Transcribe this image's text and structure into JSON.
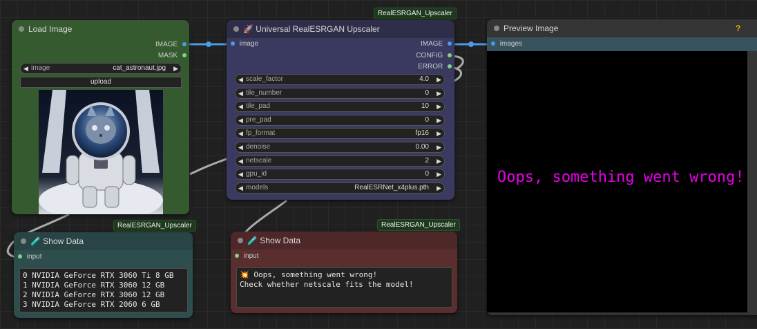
{
  "load_image": {
    "title": "Load Image",
    "outputs": [
      "IMAGE",
      "MASK"
    ],
    "image_widget": {
      "label": "image",
      "value": "cat_astronaut.jpg"
    },
    "upload_label": "upload"
  },
  "upscaler": {
    "badge": "RealESRGAN_Upscaler",
    "title": "Universal RealESRGAN Upscaler",
    "input": "image",
    "outputs": [
      "IMAGE",
      "CONFIG",
      "ERROR"
    ],
    "widgets": [
      {
        "label": "scale_factor",
        "value": "4.0"
      },
      {
        "label": "tile_number",
        "value": "0"
      },
      {
        "label": "tile_pad",
        "value": "10"
      },
      {
        "label": "pre_pad",
        "value": "0"
      },
      {
        "label": "fp_format",
        "value": "fp16"
      },
      {
        "label": "denoise",
        "value": "0.00"
      },
      {
        "label": "netscale",
        "value": "2"
      },
      {
        "label": "gpu_id",
        "value": "0"
      },
      {
        "label": "models",
        "value": "RealESRNet_x4plus.pth"
      }
    ]
  },
  "preview": {
    "title": "Preview Image",
    "help": "?",
    "input": "images",
    "error_text": "Oops, something went wrong!",
    "error_color": "#e800e8"
  },
  "show_data_1": {
    "badge": "RealESRGAN_Upscaler",
    "title": "Show Data",
    "input": "input",
    "text": "0 NVIDIA GeForce RTX 3060 Ti 8 GB\n1 NVIDIA GeForce RTX 3060 12 GB\n2 NVIDIA GeForce RTX 3060 12 GB\n3 NVIDIA GeForce RTX 2060 6 GB"
  },
  "show_data_2": {
    "badge": "RealESRGAN_Upscaler",
    "title": "Show Data",
    "input": "input",
    "text": "💥 Oops, something went wrong!\nCheck whether netscale fits the model!"
  },
  "colors": {
    "image_link": "#4a9be8",
    "data_link": "#b0b0b0",
    "load_node_bg": "#365a2f",
    "upscaler_bg": "#3a3a60",
    "show1_bg": "#2e4e4e",
    "show2_bg": "#5a2e2e",
    "preview_bg": "#353535"
  }
}
